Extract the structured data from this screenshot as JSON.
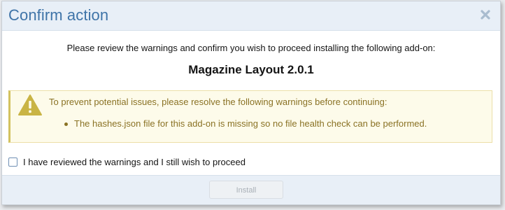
{
  "dialog": {
    "title": "Confirm action",
    "intro": "Please review the warnings and confirm you wish to proceed installing the following add-on:",
    "addon_name": "Magazine Layout 2.0.1",
    "close_icon": "close-icon"
  },
  "warning": {
    "icon": "warning-triangle-icon",
    "title": "To prevent potential issues, please resolve the following warnings before continuing:",
    "items": [
      "The hashes.json file for this add-on is missing so no file health check can be performed."
    ]
  },
  "confirm": {
    "checked": false,
    "label": "I have reviewed the warnings and I still wish to proceed"
  },
  "footer": {
    "install_label": "Install",
    "install_disabled": true
  },
  "colors": {
    "title": "#3f74a8",
    "header_bg": "#e8eff7",
    "warning_bg": "#fdfbea",
    "warning_text": "#8a7224",
    "warning_icon": "#c9b445"
  }
}
